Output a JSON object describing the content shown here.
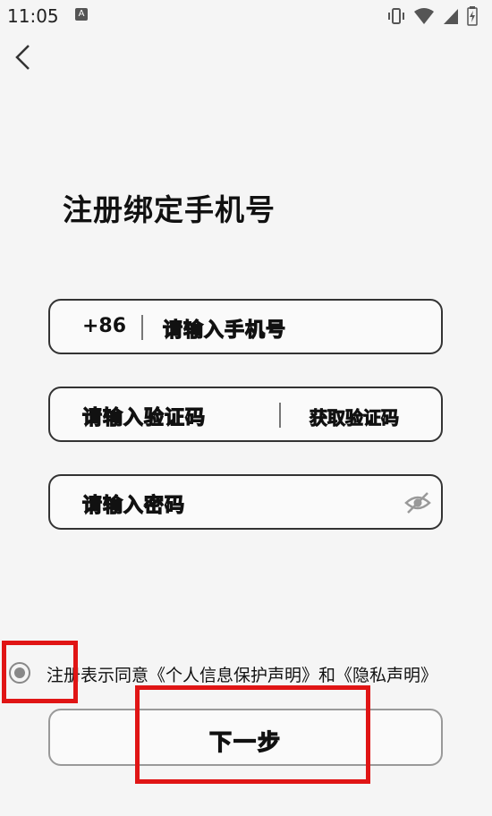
{
  "status_bar": {
    "time": "11:05",
    "notification_badge": "A",
    "icons": [
      "vibrate-icon",
      "wifi-icon",
      "signal-icon",
      "battery-icon"
    ]
  },
  "header": {
    "back_icon": "chevron-left-icon"
  },
  "title": "注册绑定手机号",
  "phone_field": {
    "prefix": "+86",
    "placeholder": "请输入手机号"
  },
  "code_field": {
    "placeholder": "请输入验证码",
    "get_code_label": "获取验证码"
  },
  "password_field": {
    "placeholder": "请输入密码",
    "toggle_icon": "eye-off-icon"
  },
  "agreement": {
    "text": "注册表示同意《个人信息保护声明》和《隐私声明》"
  },
  "next_button": {
    "label": "下一步"
  },
  "colors": {
    "background": "#f5f5f5",
    "border": "#333333",
    "highlight": "#e01515"
  }
}
